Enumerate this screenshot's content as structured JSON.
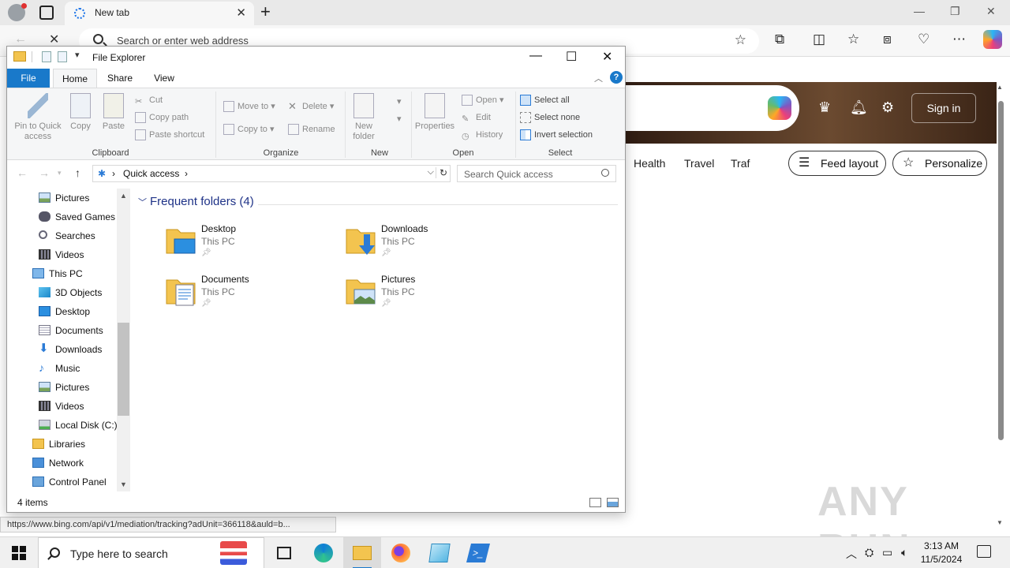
{
  "browser": {
    "tab_title": "New tab",
    "address_placeholder": "Search or enter web address",
    "signin_label": "Sign in",
    "feed_nav": [
      "Health",
      "Travel",
      "Traf"
    ],
    "feed_layout_label": "Feed layout",
    "personalize_label": "Personalize",
    "status_url": "https://www.bing.com/api/v1/mediation/tracking?adUnit=366118&auld=b...",
    "watermark": "ANY RUN"
  },
  "explorer": {
    "title": "File Explorer",
    "ribbon_tabs": [
      "File",
      "Home",
      "Share",
      "View"
    ],
    "clipboard": {
      "pin_label": "Pin to Quick access",
      "copy_label": "Copy",
      "paste_label": "Paste",
      "cut_label": "Cut",
      "copy_path_label": "Copy path",
      "paste_shortcut_label": "Paste shortcut",
      "group_label": "Clipboard"
    },
    "organize": {
      "move_to_label": "Move to",
      "copy_to_label": "Copy to",
      "delete_label": "Delete",
      "rename_label": "Rename",
      "group_label": "Organize"
    },
    "new": {
      "new_folder_label": "New folder",
      "group_label": "New"
    },
    "open": {
      "properties_label": "Properties",
      "open_label": "Open",
      "edit_label": "Edit",
      "history_label": "History",
      "group_label": "Open"
    },
    "select": {
      "select_all_label": "Select all",
      "select_none_label": "Select none",
      "invert_label": "Invert selection",
      "group_label": "Select"
    },
    "breadcrumb": [
      "Quick access"
    ],
    "search_placeholder": "Search Quick access",
    "nav_tree": [
      {
        "label": "Pictures",
        "icon": "pictures-icon"
      },
      {
        "label": "Saved Games",
        "icon": "saved-games-icon"
      },
      {
        "label": "Searches",
        "icon": "searches-icon"
      },
      {
        "label": "Videos",
        "icon": "videos-icon"
      },
      {
        "label": "This PC",
        "icon": "this-pc-icon"
      },
      {
        "label": "3D Objects",
        "icon": "3d-objects-icon"
      },
      {
        "label": "Desktop",
        "icon": "desktop-icon"
      },
      {
        "label": "Documents",
        "icon": "documents-icon"
      },
      {
        "label": "Downloads",
        "icon": "downloads-icon"
      },
      {
        "label": "Music",
        "icon": "music-icon"
      },
      {
        "label": "Pictures",
        "icon": "pictures-icon"
      },
      {
        "label": "Videos",
        "icon": "videos-icon"
      },
      {
        "label": "Local Disk (C:)",
        "icon": "local-disk-icon"
      },
      {
        "label": "Libraries",
        "icon": "libraries-icon"
      },
      {
        "label": "Network",
        "icon": "network-icon"
      },
      {
        "label": "Control Panel",
        "icon": "control-panel-icon"
      }
    ],
    "group_header": "Frequent folders (4)",
    "folders": [
      {
        "name": "Desktop",
        "location": "This PC"
      },
      {
        "name": "Downloads",
        "location": "This PC"
      },
      {
        "name": "Documents",
        "location": "This PC"
      },
      {
        "name": "Pictures",
        "location": "This PC"
      }
    ],
    "item_count": "4 items"
  },
  "taskbar": {
    "search_placeholder": "Type here to search",
    "time": "3:13 AM",
    "date": "11/5/2024"
  },
  "colors": {
    "accent": "#1979ca",
    "folder_yellow": "#f3c44f",
    "header_blue": "#1e3287"
  }
}
